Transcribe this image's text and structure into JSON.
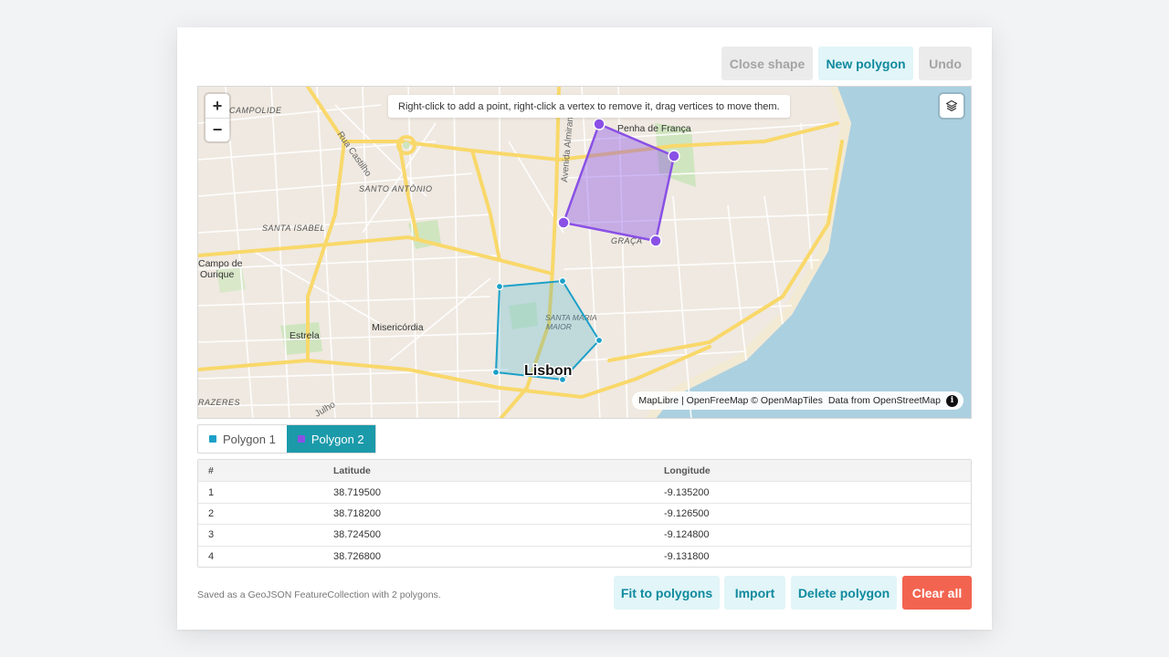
{
  "toolbar": {
    "close_shape": "Close shape",
    "new_polygon": "New polygon",
    "undo": "Undo"
  },
  "map": {
    "hint": "Right-click to add a point, right-click a vertex to remove it, drag vertices to move them.",
    "zoom_in": "+",
    "zoom_out": "−",
    "attribution": {
      "maplibre": "MapLibre | OpenFreeMap © OpenMapTiles",
      "data_from": "Data from",
      "osm": "OpenStreetMap",
      "info": "i"
    },
    "labels": {
      "campolide": "CAMPOLIDE",
      "rua_castilho": "Rua Castilho",
      "santo_antonio": "SANTO ANTÓNIO",
      "santa_isabel": "SANTA ISABEL",
      "campo_de": "Campo de",
      "ourique": "Ourique",
      "estrela": "Estrela",
      "misericordia": "Misericórdia",
      "prazeres": "RAZERES",
      "julho": "Julho",
      "penha": "Penha de França",
      "graca": "GRAÇA",
      "avenida": "Avenida Almirante",
      "santa_maria": "SANTA MARIA",
      "maior": "MAIOR",
      "lisbon": "Lisbon"
    },
    "colors": {
      "polygon1": "#1ca0c8",
      "polygon2": "#8a50e6",
      "water": "#abd0e0",
      "land": "#efe9e1",
      "road": "#f9d86a"
    }
  },
  "tabs": [
    {
      "label": "Polygon 1",
      "color": "#1ca0c8",
      "active": false
    },
    {
      "label": "Polygon 2",
      "color": "#8a50e6",
      "active": true
    }
  ],
  "table": {
    "headers": {
      "index": "#",
      "lat": "Latitude",
      "lng": "Longitude"
    },
    "rows": [
      {
        "index": "1",
        "lat": "38.719500",
        "lng": "-9.135200"
      },
      {
        "index": "2",
        "lat": "38.718200",
        "lng": "-9.126500"
      },
      {
        "index": "3",
        "lat": "38.724500",
        "lng": "-9.124800"
      },
      {
        "index": "4",
        "lat": "38.726800",
        "lng": "-9.131800"
      }
    ]
  },
  "footer": {
    "note": "Saved as a GeoJSON FeatureCollection with 2 polygons.",
    "fit": "Fit to polygons",
    "import": "Import",
    "delete": "Delete polygon",
    "clear": "Clear all"
  }
}
